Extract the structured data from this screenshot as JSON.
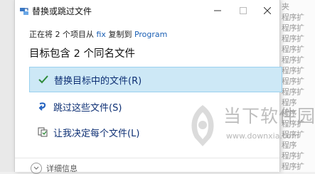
{
  "dialog": {
    "title": "替换或跳过文件",
    "subtitle": {
      "prefix": "正在将 2 个项目从 ",
      "source": "fix",
      "middle": " 复制到 ",
      "destination": "Program"
    },
    "heading": "目标包含 2 个同名文件",
    "options": [
      {
        "label": "替换目标中的文件(R)",
        "icon": "check-icon",
        "selected": true
      },
      {
        "label": "跳过这些文件(S)",
        "icon": "skip-arrow-icon",
        "selected": false
      },
      {
        "label": "让我决定每个文件(L)",
        "icon": "copy-files-icon",
        "selected": false
      }
    ],
    "details_label": "详细信息"
  },
  "background_explorer": {
    "lines": [
      "夹",
      "程序扩",
      "程序扩",
      "程序扩",
      "程序扩",
      "程序扩",
      "程序扩",
      "程序扩",
      "程序扩",
      "程序",
      "程序",
      "程序扩",
      "程序扩",
      "程序",
      "程序扩",
      "程序扩"
    ]
  },
  "watermark": {
    "brand": "当下软件园",
    "url": "www.downxia.com"
  },
  "colors": {
    "selection_bg": "#cde8f6",
    "selection_border": "#99d1ef",
    "option_text": "#0d2f74",
    "link": "#1a5fb4"
  }
}
